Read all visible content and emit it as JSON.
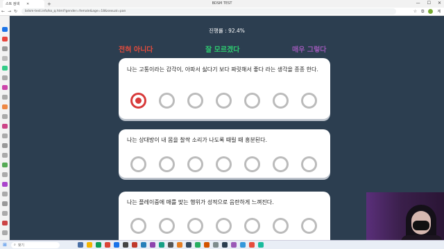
{
  "browser": {
    "tab_title": "스트 검색",
    "window_title": "BDSM TEST",
    "url": "bdsm-test.info/ko_q.html?gender=female&age=18&sexual=pan",
    "profile_label": "계",
    "win_minimize": "—",
    "win_maximize": "☐",
    "win_close": "✕"
  },
  "page": {
    "progress": "진행률 : 92.4%",
    "scale": {
      "left": "전혀 아니다",
      "middle": "잘 모르겠다",
      "right": "매우 그렇다"
    },
    "questions": [
      {
        "text": "나는 고통이라는 감각이, 아파서 싫다기 보다 짜릿해서 좋다 라는 생각을 종종 한다.",
        "selected_option": 1
      },
      {
        "text": "나는 상대방이 내 몸을 찰싹 소리가 나도록 때릴 때 흥분된다.",
        "selected_option": null
      },
      {
        "text": "나는 플레이중에 매를 맞는 행위가 성적으로 음란하게 느껴진다.",
        "selected_option": null
      }
    ]
  },
  "taskbar": {
    "search_placeholder": "찾기"
  },
  "colors": {
    "page_bg": "#2c3e50",
    "disagree": "#e74c3c",
    "neutral": "#2ecc71",
    "agree": "#9b59b6",
    "selected": "#d83a3a"
  }
}
